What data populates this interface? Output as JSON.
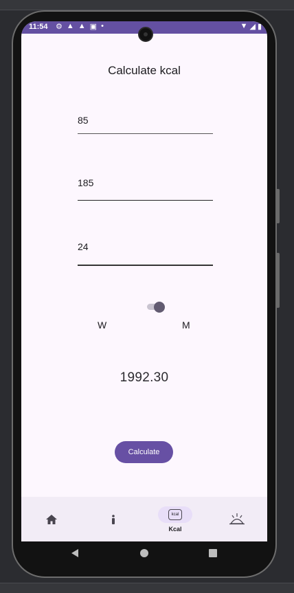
{
  "status_bar": {
    "time": "11:54",
    "left_icons": [
      "gear-icon",
      "warning-icon",
      "warning-icon",
      "sim-icon",
      "dot-icon"
    ],
    "right_icons": [
      "wifi-icon",
      "signal-icon",
      "battery-icon"
    ]
  },
  "page": {
    "title": "Calculate kcal"
  },
  "form": {
    "weight_value": "85",
    "height_value": "185",
    "age_value": "24",
    "gender_switch_on": true,
    "label_w": "W",
    "label_m": "M"
  },
  "result": {
    "value": "1992.30"
  },
  "actions": {
    "calculate_label": "Calculate"
  },
  "bottom_nav": {
    "items": [
      {
        "icon": "home-icon",
        "label": ""
      },
      {
        "icon": "person-icon",
        "label": ""
      },
      {
        "icon": "kcal-icon",
        "label": "Kcal",
        "active": true,
        "icon_text": "kcal"
      },
      {
        "icon": "sunrise-icon",
        "label": ""
      }
    ]
  },
  "colors": {
    "accent": "#6750A4",
    "status_bar": "#6450A2",
    "background": "#FDF7FE",
    "nav_background": "#F2ECF6",
    "nav_indicator": "#E8DEF8"
  }
}
